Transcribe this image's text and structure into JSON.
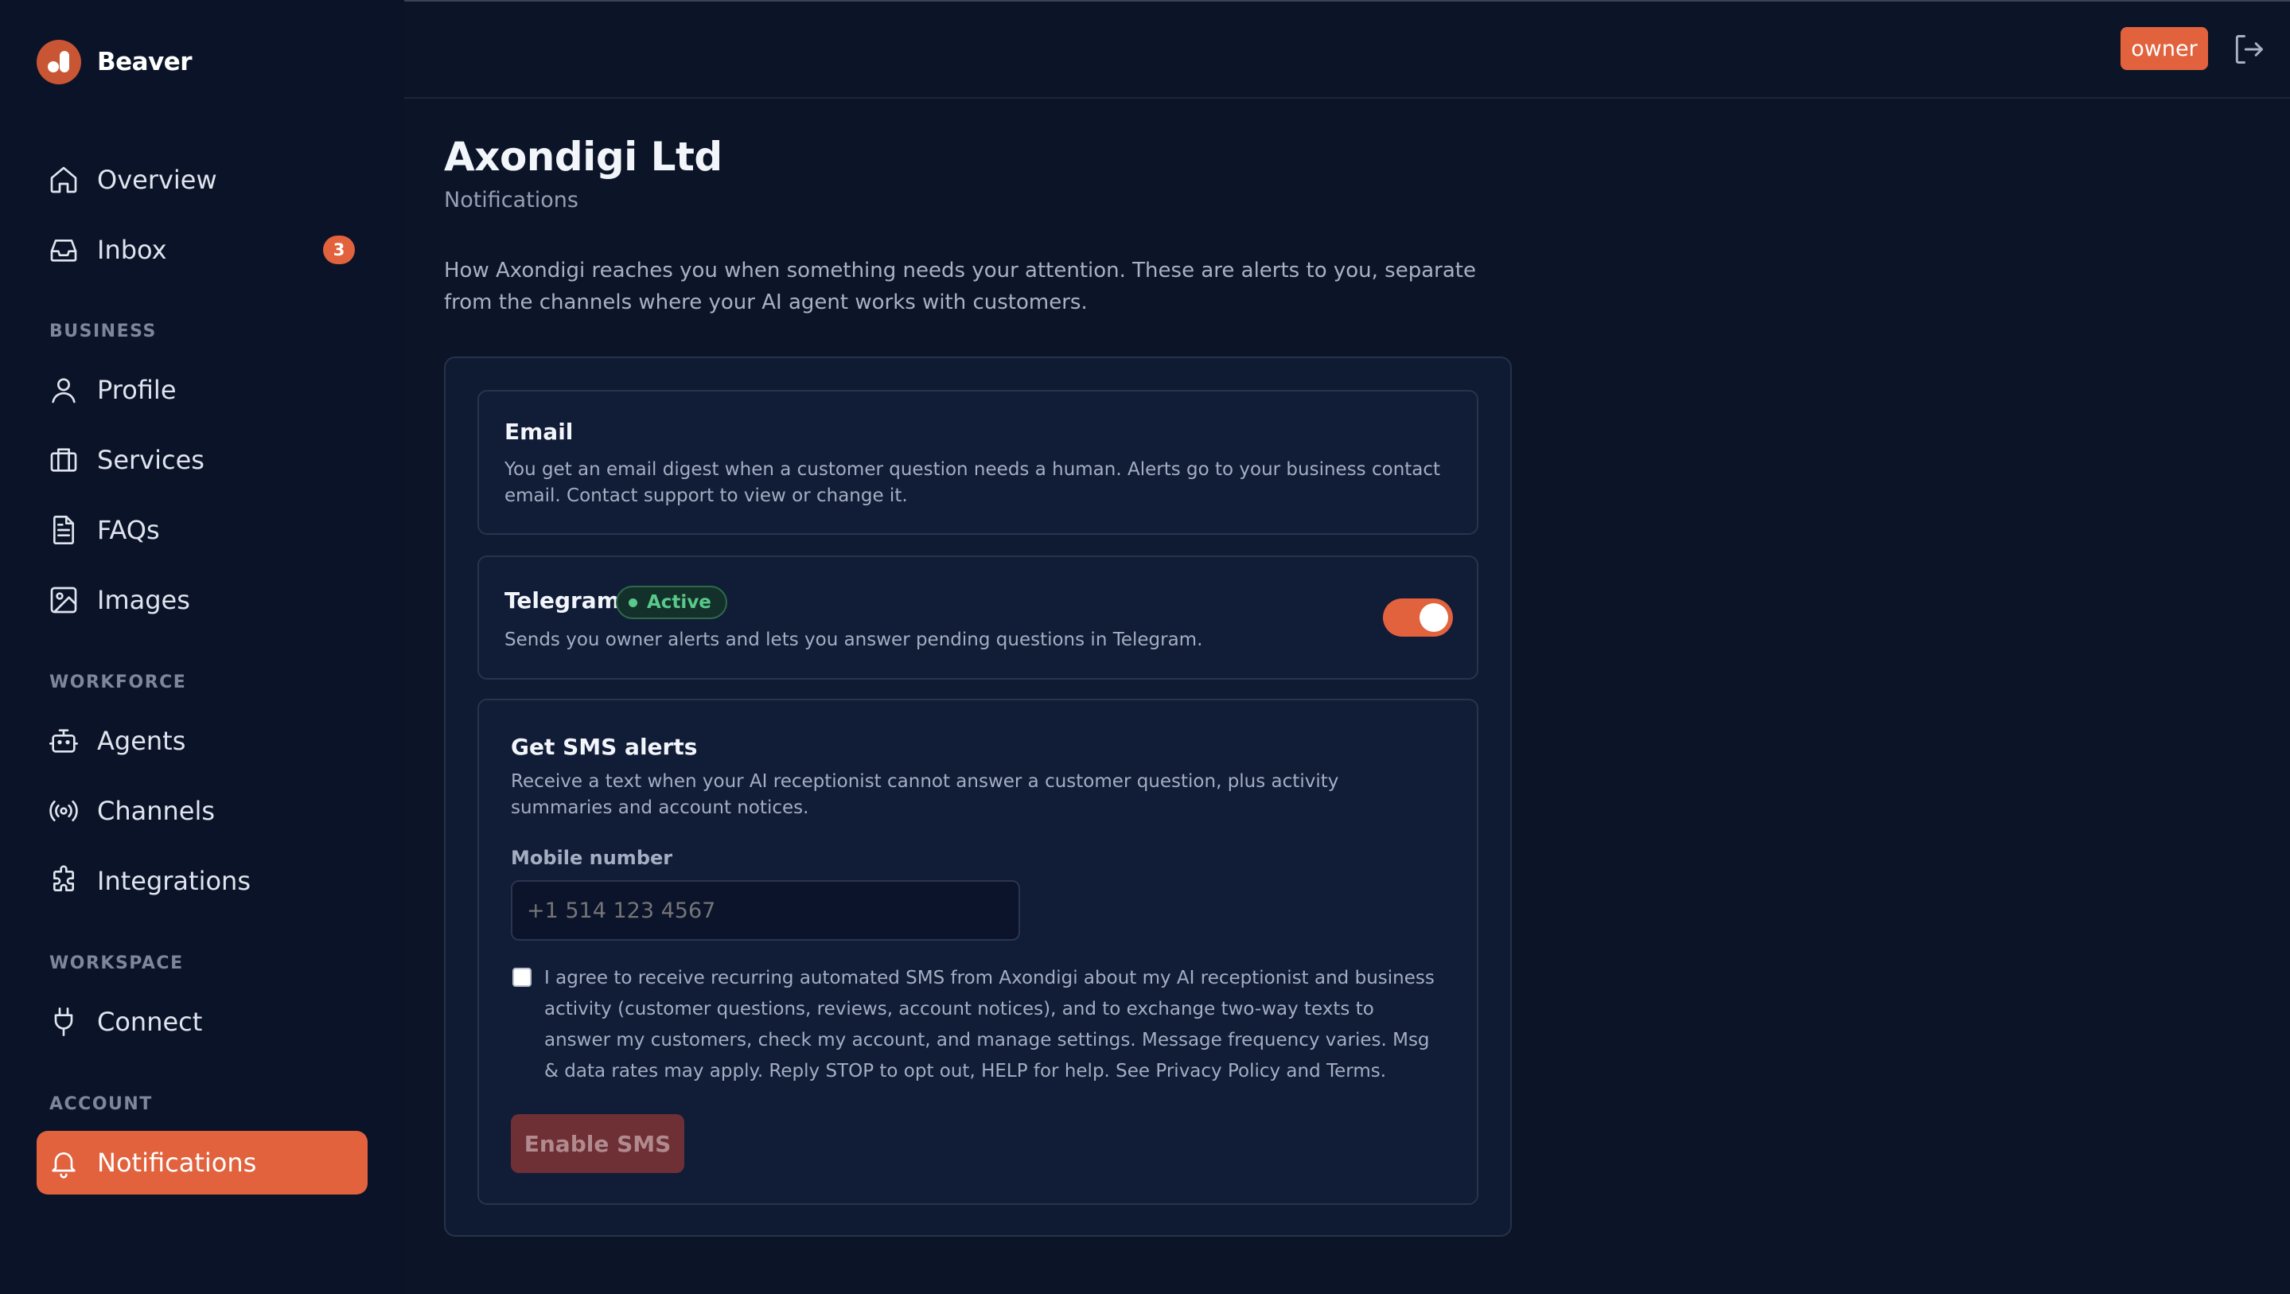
{
  "brand": {
    "name": "Beaver"
  },
  "sidebar": {
    "items": [
      {
        "label": "Overview",
        "icon": "home-icon"
      },
      {
        "label": "Inbox",
        "icon": "inbox-icon",
        "badge": "3"
      }
    ],
    "sections": [
      {
        "title": "BUSINESS",
        "items": [
          {
            "label": "Profile",
            "icon": "user-icon"
          },
          {
            "label": "Services",
            "icon": "briefcase-icon"
          },
          {
            "label": "FAQs",
            "icon": "document-icon"
          },
          {
            "label": "Images",
            "icon": "image-icon"
          }
        ]
      },
      {
        "title": "WORKFORCE",
        "items": [
          {
            "label": "Agents",
            "icon": "bot-icon"
          },
          {
            "label": "Channels",
            "icon": "broadcast-icon"
          },
          {
            "label": "Integrations",
            "icon": "puzzle-icon"
          }
        ]
      },
      {
        "title": "WORKSPACE",
        "items": [
          {
            "label": "Connect",
            "icon": "plug-icon"
          }
        ]
      },
      {
        "title": "ACCOUNT",
        "items": [
          {
            "label": "Notifications",
            "icon": "bell-icon",
            "active": true
          }
        ]
      }
    ]
  },
  "header": {
    "role_badge": "owner",
    "logout_icon": "logout-icon"
  },
  "page": {
    "title": "Axondigi Ltd",
    "subtitle": "Notifications",
    "intro": "How Axondigi reaches you when something needs your attention. These are alerts to you, separate from the channels where your AI agent works with customers."
  },
  "email_card": {
    "title": "Email",
    "description": "You get an email digest when a customer question needs a human. Alerts go to your business contact email. Contact support to view or change it."
  },
  "telegram_card": {
    "title": "Telegram",
    "status": "Active",
    "description": "Sends you owner alerts and lets you answer pending questions in Telegram.",
    "enabled": true
  },
  "sms_card": {
    "title": "Get SMS alerts",
    "description": "Receive a text when your AI receptionist cannot answer a customer question, plus activity summaries and account notices.",
    "phone_label": "Mobile number",
    "phone_placeholder": "+1 514 123 4567",
    "consent_checked": false,
    "consent_text": "I agree to receive recurring automated SMS from Axondigi about my AI receptionist and business activity (customer questions, reviews, account notices), and to exchange two-way texts to answer my customers, check my account, and manage settings. Message frequency varies. Msg & data rates may apply. Reply STOP to opt out, HELP for help. See Privacy Policy and Terms.",
    "button_label": "Enable SMS"
  },
  "colors": {
    "background": "#0c1428",
    "accent": "#e1623d",
    "active_status": "#58c98a",
    "disabled_button": "#6e2f35"
  }
}
